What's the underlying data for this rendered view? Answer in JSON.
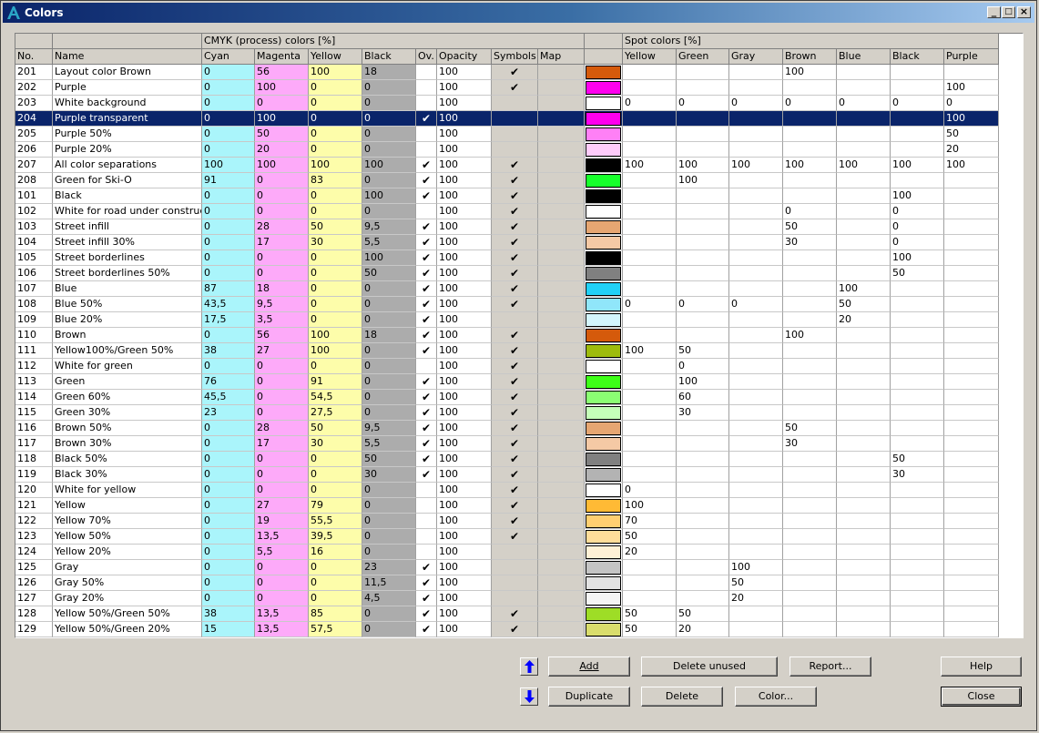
{
  "window": {
    "title": "Colors",
    "min_label": "_",
    "max_label": "□",
    "close_label": "×"
  },
  "headers": {
    "group_cmyk": "CMYK (process) colors [%]",
    "group_spot": "Spot colors [%]",
    "columns": [
      "No.",
      "Name",
      "Cyan",
      "Magenta",
      "Yellow",
      "Black",
      "Ov.",
      "Opacity",
      "Symbols",
      "Map",
      "",
      "Yellow",
      "Green",
      "Gray",
      "Brown",
      "Blue",
      "Black",
      "Purple"
    ]
  },
  "rows": [
    {
      "no": "201",
      "name": "Layout color Brown",
      "c": "0",
      "m": "56",
      "y": "100",
      "k": "18",
      "ov": false,
      "op": "100",
      "sym": true,
      "color": "#d55a0b",
      "spot": [
        "",
        "",
        "",
        "100",
        "",
        "",
        ""
      ]
    },
    {
      "no": "202",
      "name": "Purple",
      "c": "0",
      "m": "100",
      "y": "0",
      "k": "0",
      "ov": false,
      "op": "100",
      "sym": true,
      "color": "#ff00ee",
      "spot": [
        "",
        "",
        "",
        "",
        "",
        "",
        "100"
      ]
    },
    {
      "no": "203",
      "name": "White background",
      "c": "0",
      "m": "0",
      "y": "0",
      "k": "0",
      "ov": false,
      "op": "100",
      "sym": false,
      "color": "#ffffff",
      "spot": [
        "0",
        "0",
        "0",
        "0",
        "0",
        "0",
        "0"
      ]
    },
    {
      "no": "204",
      "name": "Purple transparent",
      "c": "0",
      "m": "100",
      "y": "0",
      "k": "0",
      "ov": true,
      "op": "100",
      "sym": false,
      "color": "#ff00ee",
      "spot": [
        "",
        "",
        "",
        "",
        "",
        "",
        "100"
      ],
      "selected": true
    },
    {
      "no": "205",
      "name": "Purple 50%",
      "c": "0",
      "m": "50",
      "y": "0",
      "k": "0",
      "ov": false,
      "op": "100",
      "sym": false,
      "color": "#ff80f6",
      "spot": [
        "",
        "",
        "",
        "",
        "",
        "",
        "50"
      ]
    },
    {
      "no": "206",
      "name": "Purple 20%",
      "c": "0",
      "m": "20",
      "y": "0",
      "k": "0",
      "ov": false,
      "op": "100",
      "sym": false,
      "color": "#ffccfb",
      "spot": [
        "",
        "",
        "",
        "",
        "",
        "",
        "20"
      ]
    },
    {
      "no": "207",
      "name": "All color separations",
      "c": "100",
      "m": "100",
      "y": "100",
      "k": "100",
      "ov": true,
      "op": "100",
      "sym": true,
      "color": "#000000",
      "spot": [
        "100",
        "100",
        "100",
        "100",
        "100",
        "100",
        "100"
      ]
    },
    {
      "no": "208",
      "name": "Green for Ski-O",
      "c": "91",
      "m": "0",
      "y": "83",
      "k": "0",
      "ov": true,
      "op": "100",
      "sym": true,
      "color": "#17ff2b",
      "spot": [
        "",
        "100",
        "",
        "",
        "",
        "",
        ""
      ]
    },
    {
      "no": "101",
      "name": "Black",
      "c": "0",
      "m": "0",
      "y": "0",
      "k": "100",
      "ov": true,
      "op": "100",
      "sym": true,
      "color": "#000000",
      "spot": [
        "",
        "",
        "",
        "",
        "",
        "100",
        ""
      ]
    },
    {
      "no": "102",
      "name": "White for road under construct.",
      "c": "0",
      "m": "0",
      "y": "0",
      "k": "0",
      "ov": false,
      "op": "100",
      "sym": true,
      "color": "#ffffff",
      "spot": [
        "",
        "",
        "",
        "0",
        "",
        "0",
        ""
      ]
    },
    {
      "no": "103",
      "name": "Street infill",
      "c": "0",
      "m": "28",
      "y": "50",
      "k": "9,5",
      "ov": true,
      "op": "100",
      "sym": true,
      "color": "#e6a672",
      "spot": [
        "",
        "",
        "",
        "50",
        "",
        "0",
        ""
      ]
    },
    {
      "no": "104",
      "name": "Street infill 30%",
      "c": "0",
      "m": "17",
      "y": "30",
      "k": "5,5",
      "ov": true,
      "op": "100",
      "sym": true,
      "color": "#f5c9a5",
      "spot": [
        "",
        "",
        "",
        "30",
        "",
        "0",
        ""
      ]
    },
    {
      "no": "105",
      "name": "Street borderlines",
      "c": "0",
      "m": "0",
      "y": "0",
      "k": "100",
      "ov": true,
      "op": "100",
      "sym": true,
      "color": "#000000",
      "spot": [
        "",
        "",
        "",
        "",
        "",
        "100",
        ""
      ]
    },
    {
      "no": "106",
      "name": "Street borderlines 50%",
      "c": "0",
      "m": "0",
      "y": "0",
      "k": "50",
      "ov": true,
      "op": "100",
      "sym": true,
      "color": "#808080",
      "spot": [
        "",
        "",
        "",
        "",
        "",
        "50",
        ""
      ]
    },
    {
      "no": "107",
      "name": "Blue",
      "c": "87",
      "m": "18",
      "y": "0",
      "k": "0",
      "ov": true,
      "op": "100",
      "sym": true,
      "color": "#21d1f7",
      "spot": [
        "",
        "",
        "",
        "",
        "100",
        "",
        ""
      ]
    },
    {
      "no": "108",
      "name": "Blue 50%",
      "c": "43,5",
      "m": "9,5",
      "y": "0",
      "k": "0",
      "ov": true,
      "op": "100",
      "sym": true,
      "color": "#90e6fa",
      "spot": [
        "0",
        "0",
        "0",
        "",
        "50",
        "",
        ""
      ]
    },
    {
      "no": "109",
      "name": "Blue 20%",
      "c": "17,5",
      "m": "3,5",
      "y": "0",
      "k": "0",
      "ov": true,
      "op": "100",
      "sym": false,
      "color": "#d3f5fd",
      "spot": [
        "",
        "",
        "",
        "",
        "20",
        "",
        ""
      ]
    },
    {
      "no": "110",
      "name": "Brown",
      "c": "0",
      "m": "56",
      "y": "100",
      "k": "18",
      "ov": true,
      "op": "100",
      "sym": true,
      "color": "#d55a0b",
      "spot": [
        "",
        "",
        "",
        "100",
        "",
        "",
        ""
      ]
    },
    {
      "no": "111",
      "name": "Yellow100%/Green 50%",
      "c": "38",
      "m": "27",
      "y": "100",
      "k": "0",
      "ov": true,
      "op": "100",
      "sym": true,
      "color": "#9ebb0c",
      "spot": [
        "100",
        "50",
        "",
        "",
        "",
        "",
        ""
      ]
    },
    {
      "no": "112",
      "name": "White for green",
      "c": "0",
      "m": "0",
      "y": "0",
      "k": "0",
      "ov": false,
      "op": "100",
      "sym": true,
      "color": "#ffffff",
      "spot": [
        "",
        "0",
        "",
        "",
        "",
        "",
        ""
      ]
    },
    {
      "no": "113",
      "name": "Green",
      "c": "76",
      "m": "0",
      "y": "91",
      "k": "0",
      "ov": true,
      "op": "100",
      "sym": true,
      "color": "#3dff17",
      "spot": [
        "",
        "100",
        "",
        "",
        "",
        "",
        ""
      ]
    },
    {
      "no": "114",
      "name": "Green 60%",
      "c": "45,5",
      "m": "0",
      "y": "54,5",
      "k": "0",
      "ov": true,
      "op": "100",
      "sym": true,
      "color": "#8bff73",
      "spot": [
        "",
        "60",
        "",
        "",
        "",
        "",
        ""
      ]
    },
    {
      "no": "115",
      "name": "Green 30%",
      "c": "23",
      "m": "0",
      "y": "27,5",
      "k": "0",
      "ov": true,
      "op": "100",
      "sym": true,
      "color": "#c5ffb9",
      "spot": [
        "",
        "30",
        "",
        "",
        "",
        "",
        ""
      ]
    },
    {
      "no": "116",
      "name": "Brown 50%",
      "c": "0",
      "m": "28",
      "y": "50",
      "k": "9,5",
      "ov": true,
      "op": "100",
      "sym": true,
      "color": "#e6a672",
      "spot": [
        "",
        "",
        "",
        "50",
        "",
        "",
        ""
      ]
    },
    {
      "no": "117",
      "name": "Brown 30%",
      "c": "0",
      "m": "17",
      "y": "30",
      "k": "5,5",
      "ov": true,
      "op": "100",
      "sym": true,
      "color": "#f5c9a5",
      "spot": [
        "",
        "",
        "",
        "30",
        "",
        "",
        ""
      ]
    },
    {
      "no": "118",
      "name": "Black 50%",
      "c": "0",
      "m": "0",
      "y": "0",
      "k": "50",
      "ov": true,
      "op": "100",
      "sym": true,
      "color": "#808080",
      "spot": [
        "",
        "",
        "",
        "",
        "",
        "50",
        ""
      ]
    },
    {
      "no": "119",
      "name": "Black 30%",
      "c": "0",
      "m": "0",
      "y": "0",
      "k": "30",
      "ov": true,
      "op": "100",
      "sym": true,
      "color": "#b3b3b3",
      "spot": [
        "",
        "",
        "",
        "",
        "",
        "30",
        ""
      ]
    },
    {
      "no": "120",
      "name": "White for yellow",
      "c": "0",
      "m": "0",
      "y": "0",
      "k": "0",
      "ov": false,
      "op": "100",
      "sym": true,
      "color": "#ffffff",
      "spot": [
        "0",
        "",
        "",
        "",
        "",
        "",
        ""
      ]
    },
    {
      "no": "121",
      "name": "Yellow",
      "c": "0",
      "m": "27",
      "y": "79",
      "k": "0",
      "ov": false,
      "op": "100",
      "sym": true,
      "color": "#ffba35",
      "spot": [
        "100",
        "",
        "",
        "",
        "",
        "",
        ""
      ]
    },
    {
      "no": "122",
      "name": "Yellow 70%",
      "c": "0",
      "m": "19",
      "y": "55,5",
      "k": "0",
      "ov": false,
      "op": "100",
      "sym": true,
      "color": "#ffcf71",
      "spot": [
        "70",
        "",
        "",
        "",
        "",
        "",
        ""
      ]
    },
    {
      "no": "123",
      "name": "Yellow 50%",
      "c": "0",
      "m": "13,5",
      "y": "39,5",
      "k": "0",
      "ov": false,
      "op": "100",
      "sym": true,
      "color": "#ffdd9a",
      "spot": [
        "50",
        "",
        "",
        "",
        "",
        "",
        ""
      ]
    },
    {
      "no": "124",
      "name": "Yellow 20%",
      "c": "0",
      "m": "5,5",
      "y": "16",
      "k": "0",
      "ov": false,
      "op": "100",
      "sym": false,
      "color": "#fff1d6",
      "spot": [
        "20",
        "",
        "",
        "",
        "",
        "",
        ""
      ]
    },
    {
      "no": "125",
      "name": "Gray",
      "c": "0",
      "m": "0",
      "y": "0",
      "k": "23",
      "ov": true,
      "op": "100",
      "sym": false,
      "color": "#c4c4c4",
      "spot": [
        "",
        "",
        "100",
        "",
        "",
        "",
        ""
      ]
    },
    {
      "no": "126",
      "name": "Gray 50%",
      "c": "0",
      "m": "0",
      "y": "0",
      "k": "11,5",
      "ov": true,
      "op": "100",
      "sym": false,
      "color": "#e2e2e2",
      "spot": [
        "",
        "",
        "50",
        "",
        "",
        "",
        ""
      ]
    },
    {
      "no": "127",
      "name": "Gray 20%",
      "c": "0",
      "m": "0",
      "y": "0",
      "k": "4,5",
      "ov": true,
      "op": "100",
      "sym": false,
      "color": "#f4f4f4",
      "spot": [
        "",
        "",
        "20",
        "",
        "",
        "",
        ""
      ]
    },
    {
      "no": "128",
      "name": "Yellow 50%/Green 50%",
      "c": "38",
      "m": "13,5",
      "y": "85",
      "k": "0",
      "ov": true,
      "op": "100",
      "sym": true,
      "color": "#9edd26",
      "spot": [
        "50",
        "50",
        "",
        "",
        "",
        "",
        ""
      ]
    },
    {
      "no": "129",
      "name": "Yellow 50%/Green 20%",
      "c": "15",
      "m": "13,5",
      "y": "57,5",
      "k": "0",
      "ov": true,
      "op": "100",
      "sym": true,
      "color": "#d9dd6c",
      "spot": [
        "50",
        "20",
        "",
        "",
        "",
        "",
        ""
      ]
    }
  ],
  "check_glyph": "✔",
  "buttons": {
    "add": "Add",
    "delete_unused": "Delete unused",
    "report": "Report...",
    "help": "Help",
    "duplicate": "Duplicate",
    "delete": "Delete",
    "color": "Color...",
    "close": "Close",
    "move_up_icon": "arrow-up-icon",
    "move_down_icon": "arrow-down-icon"
  }
}
